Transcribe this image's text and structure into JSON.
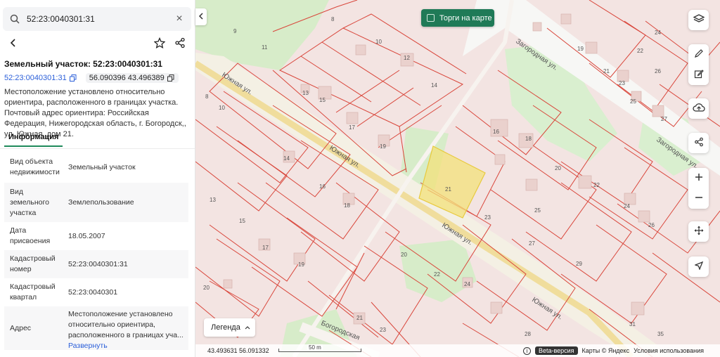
{
  "search": {
    "value": "52:23:0040301:31"
  },
  "parcel": {
    "title": "Земельный участок: 52:23:0040301:31",
    "number_link": "52:23:0040301:31",
    "coords": "56.090396 43.496389",
    "description": "Местоположение установлено относительно ориентира, расположенного в границах участка. Почтовый адрес ориентира: Российская Федерация, Нижегородская область, г. Богородск,, ул. Южная, дом 21."
  },
  "tabs": {
    "info": "Информация"
  },
  "info_rows": [
    {
      "key": "Вид объекта недвижимости",
      "value": "Земельный участок"
    },
    {
      "key": "Вид земельного участка",
      "value": "Землепользование"
    },
    {
      "key": "Дата присвоения",
      "value": "18.05.2007"
    },
    {
      "key": "Кадастровый номер",
      "value": "52:23:0040301:31"
    },
    {
      "key": "Кадастровый квартал",
      "value": "52:23:0040301"
    },
    {
      "key": "Адрес",
      "value": "Местоположение установлено относительно ориентира, расположенного в границах уча..."
    }
  ],
  "address_more": "Развернуть",
  "map": {
    "torgi_label": "Торги на карте",
    "legend_label": "Легенда",
    "cursor_coords": "43.493631 56.091332",
    "scale_label": "50 m",
    "beta_label": "Beta-версия",
    "attribution": "Карты © Яндекс",
    "terms": "Условия использования",
    "streets": {
      "yuzhnaya": "Южная ул.",
      "zagorodnaya": "Загородная ул.",
      "bogorodskaya": "Богородская"
    },
    "parcel_labels": [
      "9",
      "11",
      "8",
      "10",
      "12",
      "13",
      "13",
      "15",
      "16",
      "17",
      "18",
      "19",
      "14",
      "14",
      "15",
      "16",
      "17",
      "18",
      "19",
      "20",
      "21",
      "22",
      "23",
      "24",
      "25",
      "26",
      "27",
      "28",
      "29",
      "31",
      "35",
      "20",
      "21",
      "22",
      "23",
      "24",
      "24",
      "19",
      "21",
      "22",
      "23",
      "25",
      "26",
      "27",
      "10",
      "8",
      "20"
    ]
  },
  "colors": {
    "accent": "#1f7a57",
    "link": "#2b5fd9",
    "parcel_fill": "#f7d9d5",
    "parcel_line": "#d9463b",
    "highlight": "#f3e27a"
  }
}
